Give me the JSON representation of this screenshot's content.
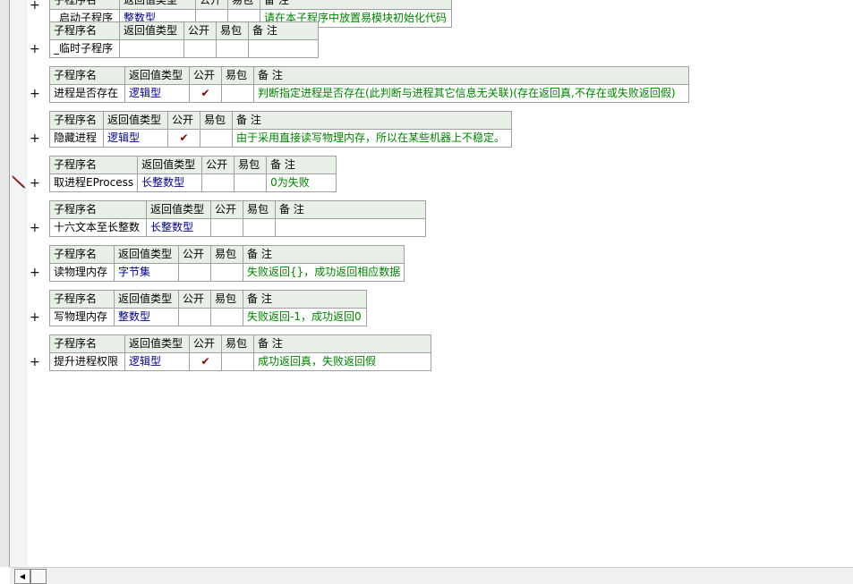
{
  "headers": {
    "name": "子程序名",
    "return_type": "返回值类型",
    "public": "公开",
    "easy_pack": "易包",
    "note": "备 注"
  },
  "expand_symbol": "+",
  "check_symbol": "✔",
  "subs": [
    {
      "name": "_启动子程序",
      "return_type": "整数型",
      "public": false,
      "note": "请在本子程序中放置易模块初始化代码"
    },
    {
      "name": "_临时子程序",
      "return_type": "",
      "public": false,
      "note": ""
    },
    {
      "name": "进程是否存在",
      "return_type": "逻辑型",
      "public": true,
      "note": "判断指定进程是否存在(此判断与进程其它信息无关联)(存在返回真,不存在或失败返回假)"
    },
    {
      "name": "隐藏进程",
      "return_type": "逻辑型",
      "public": true,
      "note": "由于采用直接读写物理内存，所以在某些机器上不稳定。"
    },
    {
      "name": "取进程EProcess",
      "return_type": "长整数型",
      "public": false,
      "note": "0为失败"
    },
    {
      "name": "十六文本至长整数",
      "return_type": "长整数型",
      "public": false,
      "note": ""
    },
    {
      "name": "读物理内存",
      "return_type": "字节集",
      "public": false,
      "note": "失败返回{}，成功返回相应数据"
    },
    {
      "name": "写物理内存",
      "return_type": "整数型",
      "public": false,
      "note": "失败返回-1，成功返回0"
    },
    {
      "name": "提升进程权限",
      "return_type": "逻辑型",
      "public": true,
      "note": "成功返回真，失败返回假"
    }
  ],
  "scrollbar": {
    "left_arrow": "◀"
  }
}
